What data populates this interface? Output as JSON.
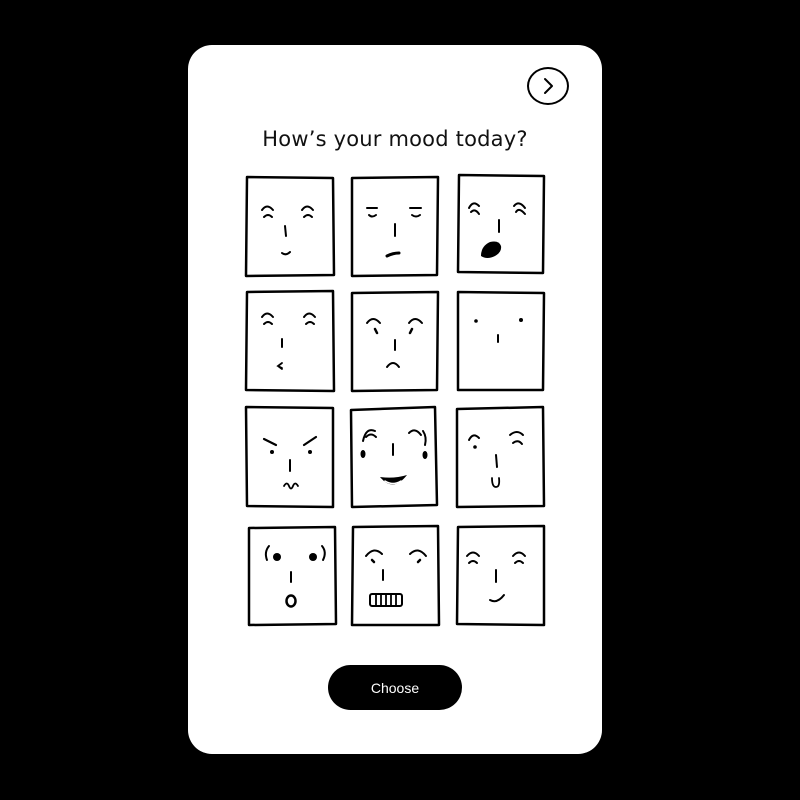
{
  "header": {
    "next_icon": "chevron-right-icon"
  },
  "title": "How’s your mood today?",
  "moods": [
    {
      "icon": "smiling-face-icon"
    },
    {
      "icon": "unimpressed-face-icon"
    },
    {
      "icon": "shocked-face-icon"
    },
    {
      "icon": "content-face-icon"
    },
    {
      "icon": "angry-face-icon"
    },
    {
      "icon": "blank-face-icon"
    },
    {
      "icon": "grumpy-face-icon"
    },
    {
      "icon": "laughing-face-icon"
    },
    {
      "icon": "skeptical-face-icon"
    },
    {
      "icon": "surprised-face-icon"
    },
    {
      "icon": "grimacing-face-icon"
    },
    {
      "icon": "happy-face-icon"
    }
  ],
  "action": {
    "choose_label": "Choose"
  }
}
